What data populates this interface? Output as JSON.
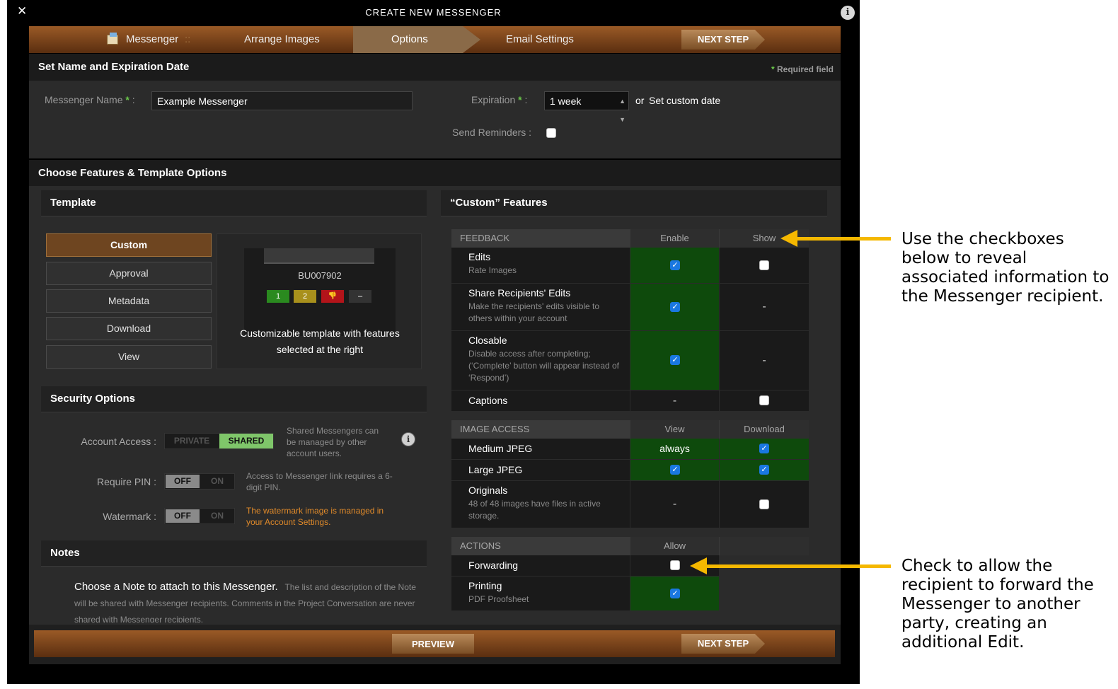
{
  "window": {
    "title": "CREATE NEW MESSENGER",
    "close_glyph": "✕",
    "info_glyph": "i"
  },
  "steps": {
    "messenger": "Messenger",
    "sep": "::",
    "arrange": "Arrange Images",
    "options": "Options",
    "email": "Email Settings",
    "next": "NEXT STEP"
  },
  "name_section": {
    "title": "Set Name and Expiration Date",
    "required_note": "Required field",
    "star": "*",
    "name_label": "Messenger Name",
    "colon": ":",
    "name_value": "Example Messenger",
    "expiration_label": "Expiration",
    "expiration_value": "1 week",
    "or": "or",
    "custom_date": "Set custom date",
    "reminders_label": "Send Reminders :"
  },
  "features_section": {
    "title": "Choose Features & Template Options"
  },
  "template": {
    "title": "Template",
    "options": [
      "Custom",
      "Approval",
      "Metadata",
      "Download",
      "View"
    ],
    "selected": "Custom",
    "preview_id": "BU007902",
    "preview_buttons": [
      "1",
      "2",
      "👎",
      "–"
    ],
    "description": "Customizable template with features selected at the right"
  },
  "security": {
    "title": "Security Options",
    "account_access_label": "Account Access :",
    "private": "PRIVATE",
    "shared": "SHARED",
    "account_hint": "Shared Messengers can be managed by other account users.",
    "pin_label": "Require PIN :",
    "off": "OFF",
    "on": "ON",
    "pin_hint": "Access to Messenger link requires a 6-digit PIN.",
    "watermark_label": "Watermark :",
    "watermark_hint": "The watermark image is managed in your Account Settings."
  },
  "notes": {
    "title": "Notes",
    "lead": "Choose a Note to attach to this Messenger.",
    "body": "The list and description of the Note will be shared with Messenger recipients. Comments in the Project Conversation are never shared with Messenger recipients."
  },
  "custom_features": {
    "title_prefix": "“Custom”",
    "title": "Features",
    "feedback": {
      "header": "FEEDBACK",
      "col1": "Enable",
      "col2": "Show"
    },
    "edits": {
      "title": "Edits",
      "sub": "Rate Images"
    },
    "share": {
      "title": "Share Recipients' Edits",
      "sub": "Make the recipients' edits visible to others within your account"
    },
    "closable": {
      "title": "Closable",
      "sub": "Disable access after completing; (‘Complete’ button will appear instead of ‘Respond’)"
    },
    "captions": {
      "title": "Captions"
    },
    "dash": "-",
    "image_access": {
      "header": "IMAGE ACCESS",
      "col1": "View",
      "col2": "Download"
    },
    "medium": {
      "title": "Medium JPEG",
      "view": "always"
    },
    "large": {
      "title": "Large JPEG"
    },
    "originals": {
      "title": "Originals",
      "sub": "48 of 48 images have files in active storage."
    },
    "actions": {
      "header": "ACTIONS",
      "col1": "Allow"
    },
    "forwarding": {
      "title": "Forwarding"
    },
    "printing": {
      "title": "Printing",
      "sub": "PDF Proofsheet"
    }
  },
  "footer": {
    "preview": "PREVIEW",
    "next": "NEXT STEP"
  },
  "annotations": {
    "top": "Use the checkboxes below to reveal associated information to the Messenger recipient.",
    "bottom": "Check to allow the recipient to forward the Messenger to another party, creating an additional Edit."
  },
  "colors": {
    "accent_arrow": "#f5b800",
    "enabled_cell": "#0e4a0c",
    "checkbox": "#1a78e0",
    "required": "#6bc94a",
    "warning_text": "#e08a2a"
  }
}
